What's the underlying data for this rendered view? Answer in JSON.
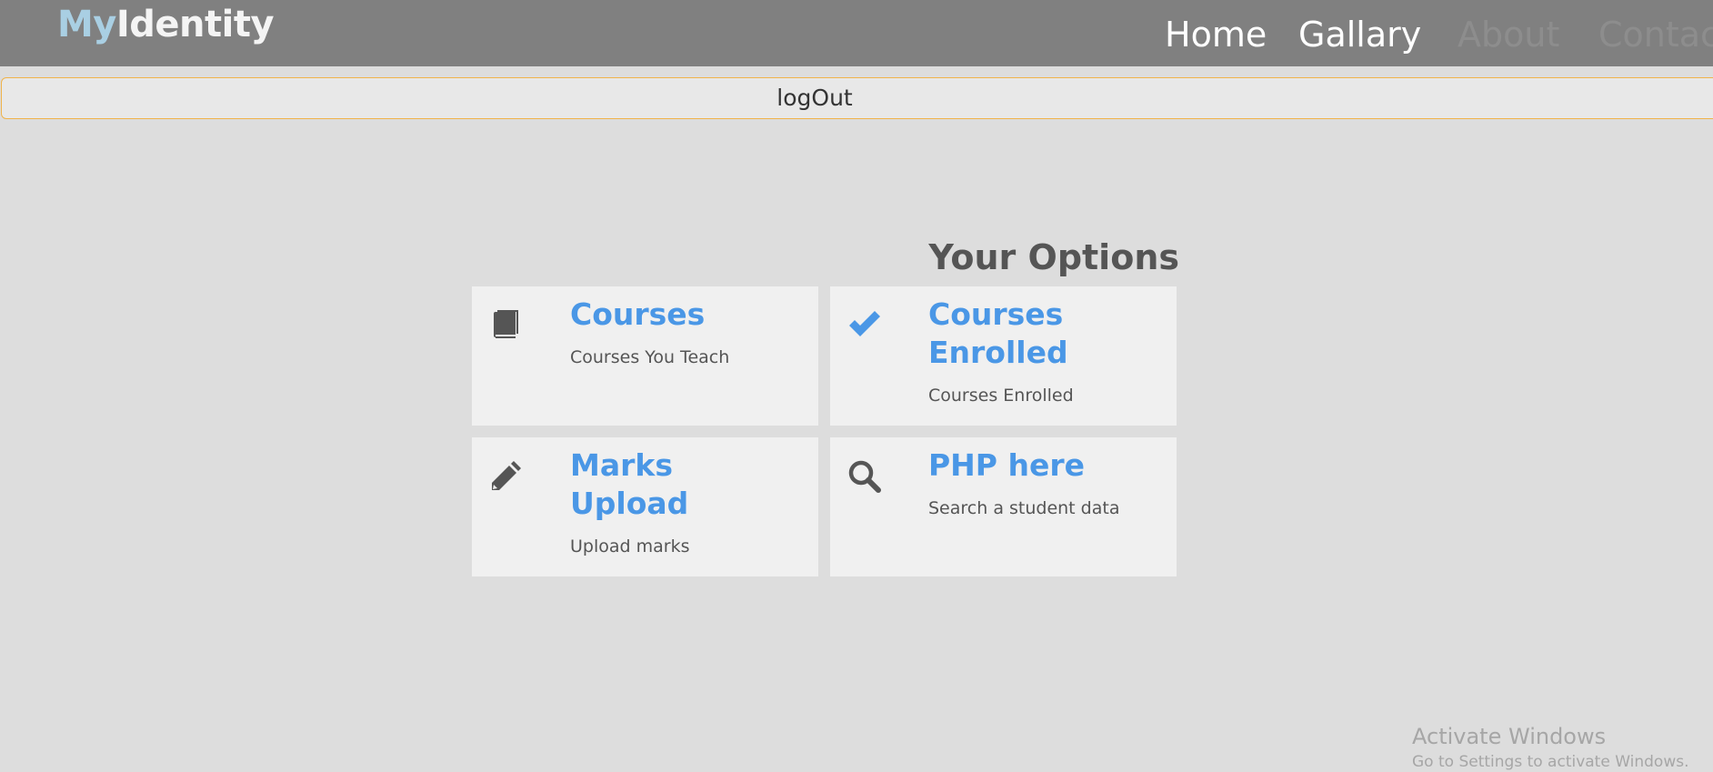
{
  "brand": {
    "part1": "My",
    "part2": "Identity"
  },
  "nav": {
    "home": "Home",
    "gallary": "Gallary",
    "about": "About",
    "contact": "Contact"
  },
  "logout": {
    "label": "logOut"
  },
  "options": {
    "title": "Your Options",
    "cards": [
      {
        "title": "Courses",
        "description": "Courses You Teach",
        "icon": "book-icon"
      },
      {
        "title": "Courses Enrolled",
        "description": "Courses Enrolled",
        "icon": "check-icon"
      },
      {
        "title": "Marks Upload",
        "description": "Upload marks",
        "icon": "pencil-icon"
      },
      {
        "title": "PHP here",
        "description": "Search a student data",
        "icon": "search-icon"
      }
    ]
  },
  "watermark": {
    "title": "Activate Windows",
    "subtitle": "Go to Settings to activate Windows."
  },
  "colors": {
    "header_bg": "#808080",
    "page_bg": "#dddddd",
    "card_bg": "#f0f0f0",
    "accent": "#4a97e6",
    "logout_border": "#f0b34a"
  }
}
